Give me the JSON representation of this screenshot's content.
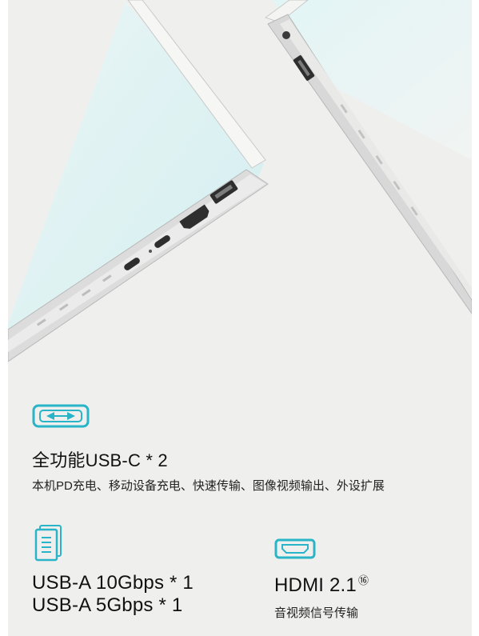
{
  "features": {
    "usbc": {
      "icon": "usb-c-port-icon",
      "title": "全功能USB-C * 2",
      "description": "本机PD充电、移动设备充电、快速传输、图像视频输出、外设扩展"
    },
    "usba": {
      "icon": "usb-a-port-icon",
      "title_line1": "USB-A 10Gbps * 1",
      "title_line2": "USB-A 5Gbps * 1"
    },
    "hdmi": {
      "icon": "hdmi-port-icon",
      "title": "HDMI 2.1",
      "footnote": "⑯",
      "description": "音视频信号传输"
    }
  },
  "colors": {
    "accent": "#2ab4c8",
    "background": "#efefee",
    "text": "#111111"
  }
}
